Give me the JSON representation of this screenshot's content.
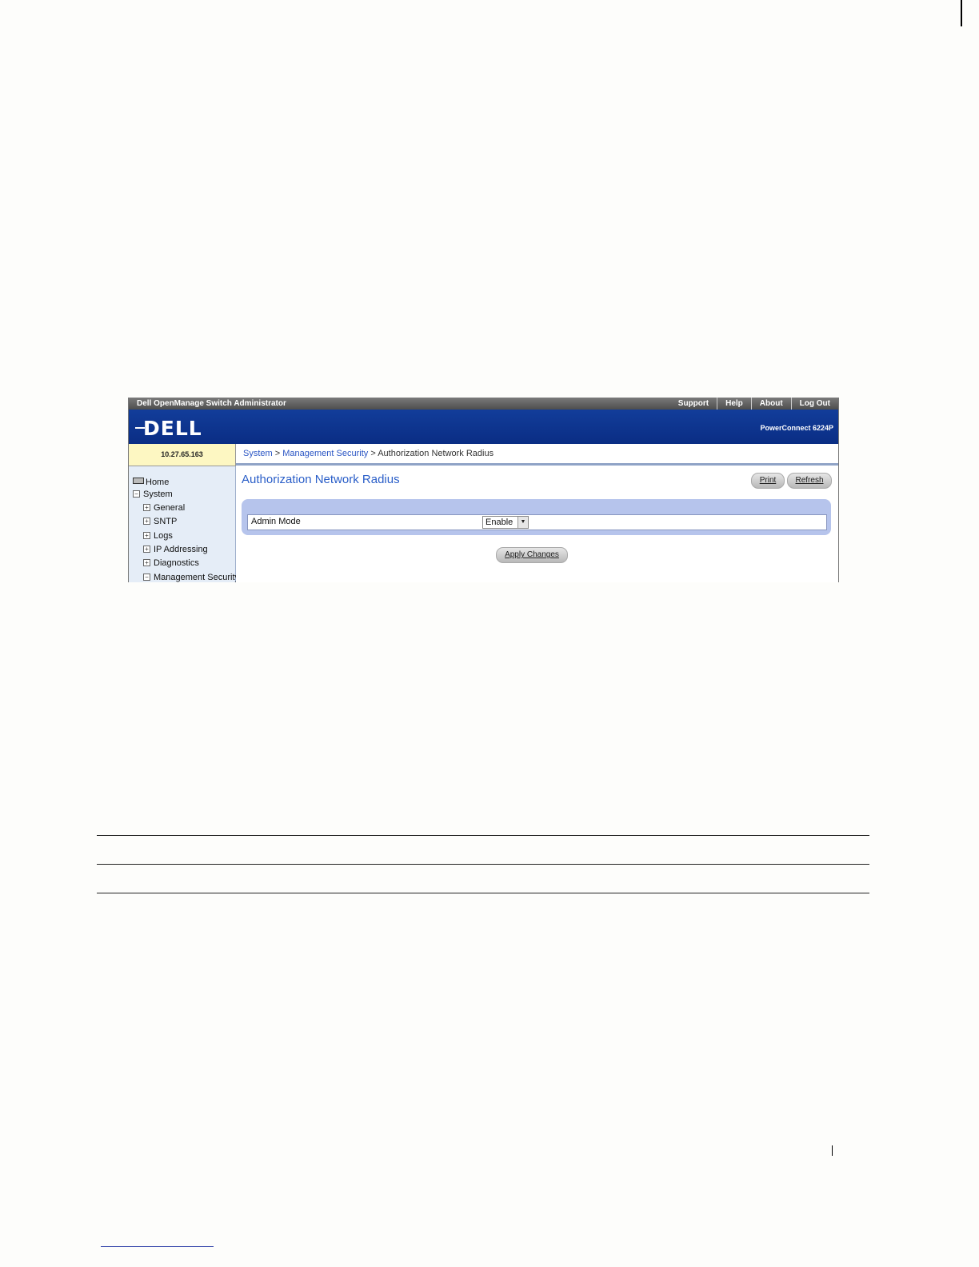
{
  "window": {
    "app_title": "Dell OpenManage Switch Administrator",
    "top_links": [
      "Support",
      "Help",
      "About",
      "Log Out"
    ],
    "logo_text": "DELL",
    "model": "PowerConnect 6224P"
  },
  "device": {
    "ip": "10.27.65.163"
  },
  "breadcrumb": {
    "items": [
      "System",
      "Management Security"
    ],
    "separator": ">",
    "current": "Authorization Network Radius"
  },
  "sidebar": {
    "home": "Home",
    "system": "System",
    "children": [
      "General",
      "SNTP",
      "Logs",
      "IP Addressing",
      "Diagnostics",
      "Management Security"
    ],
    "expand_glyph": "+",
    "collapse_glyph": "−"
  },
  "main": {
    "title": "Authorization Network Radius",
    "print_label": "Print",
    "refresh_label": "Refresh",
    "admin_mode_label": "Admin Mode",
    "admin_mode_value": "Enable",
    "apply_label": "Apply Changes"
  },
  "colors": {
    "banner": "#0a2d84",
    "title_blue": "#2a5ec8",
    "link_blue": "#2a55c4",
    "ip_box": "#fdf7c2",
    "panel": "#b6c4ec"
  }
}
